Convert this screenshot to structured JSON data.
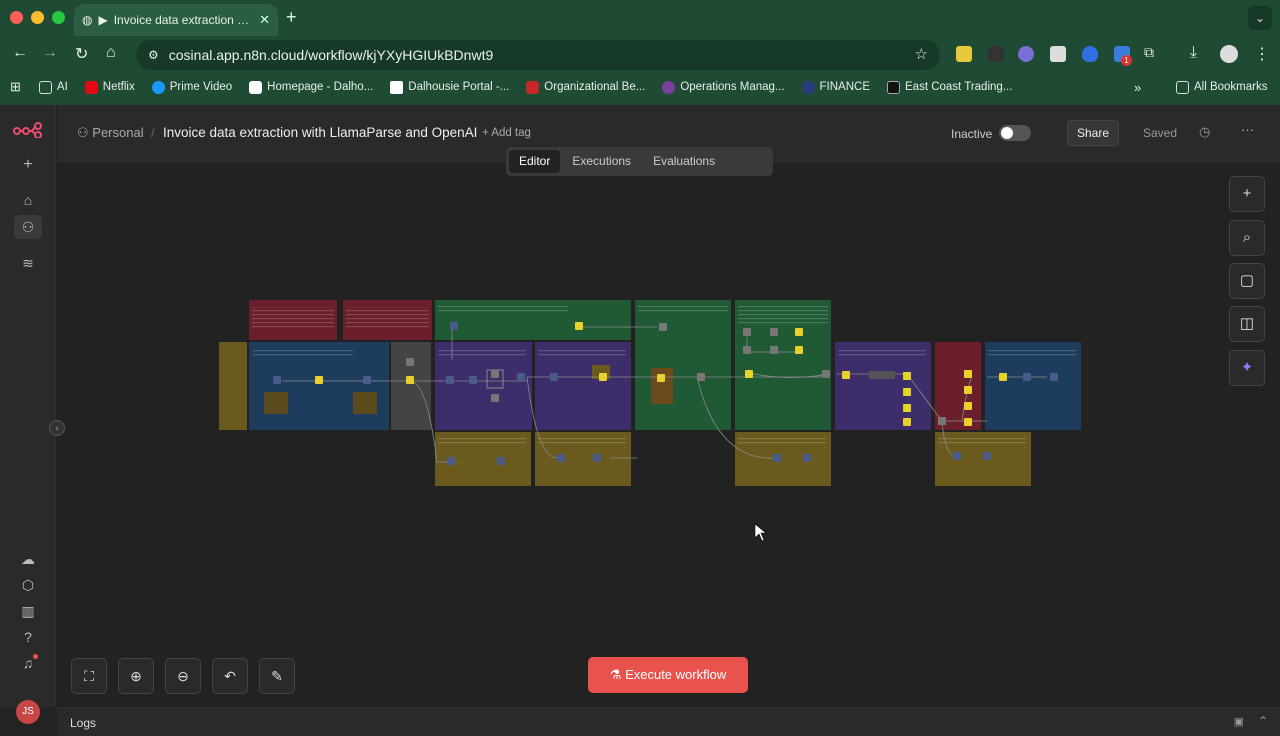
{
  "browser": {
    "tab_title": "Invoice data extraction with LlamaParse and OpenAI",
    "url": "cosinal.app.n8n.cloud/workflow/kjYXyHGIUkBDnwt9",
    "bookmarks": [
      "AI",
      "Netflix",
      "Prime Video",
      "Homepage - Dalho...",
      "Dalhousie Portal -...",
      "Organizational Be...",
      "Operations Manag...",
      "FINANCE",
      "East Coast Trading..."
    ],
    "all_bookmarks": "All Bookmarks",
    "extension_badge": "1"
  },
  "header": {
    "project": "Personal",
    "workflow_name": "Invoice data extraction with LlamaParse and OpenAI",
    "add_tag": "+ Add tag",
    "status": "Inactive",
    "share": "Share",
    "saved": "Saved"
  },
  "modes": [
    "Editor",
    "Executions",
    "Evaluations"
  ],
  "execute_button": "Execute workflow",
  "logs_label": "Logs",
  "user_initials": "JS",
  "colors": {
    "browser_chrome": "#1f4a34",
    "execute": "#e9534d",
    "sticky_red": "#6b1f2d",
    "sticky_blue": "#1e3c5e",
    "sticky_purple": "#3d2e6b",
    "sticky_green": "#1f5a35",
    "sticky_yellow": "#6b5a1e"
  }
}
